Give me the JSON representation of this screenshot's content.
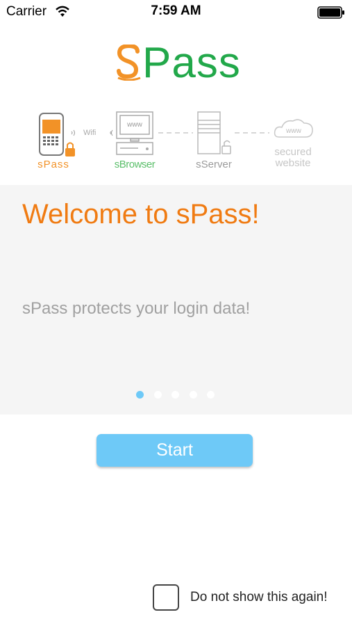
{
  "status_bar": {
    "carrier": "Carrier",
    "time": "7:59 AM",
    "wifi_icon": "wifi-icon",
    "battery_icon": "battery-icon"
  },
  "logo": {
    "text": "Pass",
    "icon": "spass-s-logo",
    "colors": {
      "green": "#22a84a",
      "orange": "#f29227"
    }
  },
  "diagram": {
    "nodes": [
      {
        "label": "sPass",
        "icon": "phone-lock-icon"
      },
      {
        "label": "sBrowser",
        "icon": "browser-computer-icon"
      },
      {
        "label": "sServer",
        "icon": "server-lock-icon"
      },
      {
        "label": "secured website",
        "icon": "cloud-www-icon"
      }
    ],
    "wifi_label": "Wifi",
    "www": "www"
  },
  "slider": {
    "title": "Welcome to sPass!",
    "text": "sPass protects your login data!",
    "page_count": 5,
    "current_page": 1,
    "accent_color": "#f07b12",
    "dot_color": "#6ec9f7"
  },
  "start_button": {
    "label": "Start",
    "color": "#6ec9f7"
  },
  "dont_show": {
    "label": "Do not show this again!",
    "checked": false
  }
}
